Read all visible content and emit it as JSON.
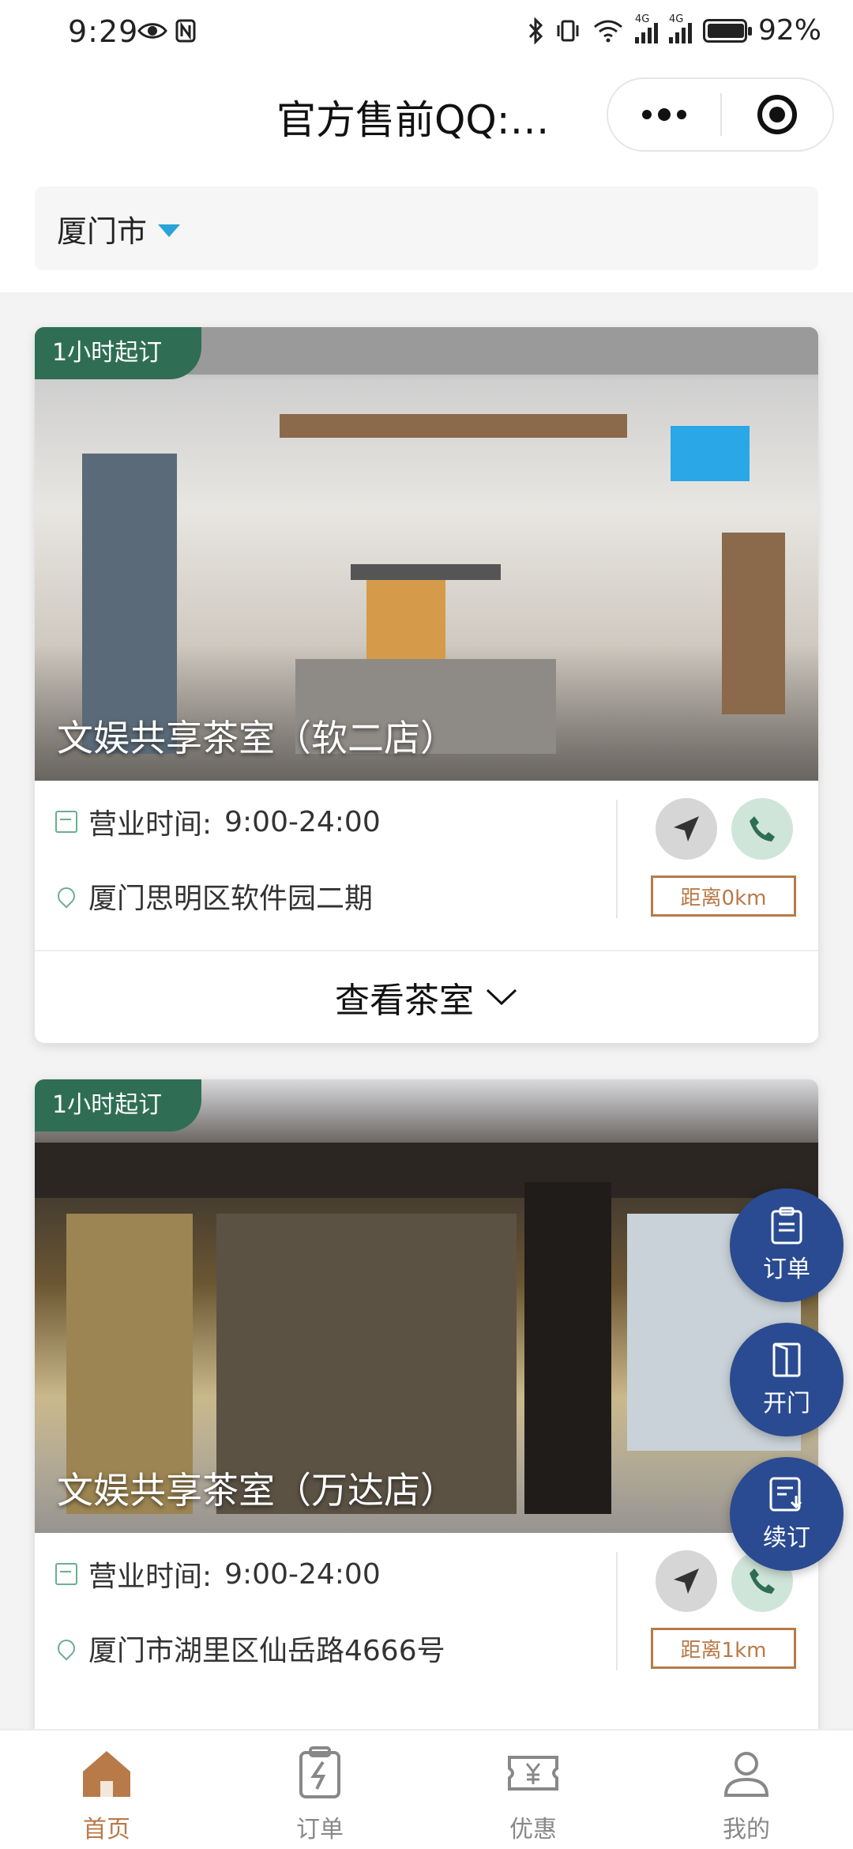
{
  "status_bar": {
    "time": "9:29",
    "battery_percent": "92%",
    "battery_level": 0.92,
    "network_labels": [
      "4G",
      "4G"
    ]
  },
  "header": {
    "title": "官方售前QQ:…",
    "more_icon": "more-dots-icon",
    "close_icon": "target-circle-icon"
  },
  "city_selector": {
    "label": "厦门市",
    "caret_color": "#2aa3d8"
  },
  "stores": [
    {
      "badge": "1小时起订",
      "name": "文娱共享茶室（软二店）",
      "hours_label": "营业时间:",
      "hours": "9:00-24:00",
      "address": "厦门思明区软件园二期",
      "distance": "距离0km",
      "view_label": "查看茶室"
    },
    {
      "badge": "1小时起订",
      "name": "文娱共享茶室（万达店）",
      "hours_label": "营业时间:",
      "hours": "9:00-24:00",
      "address": "厦门市湖里区仙岳路4666号",
      "distance": "距离1km"
    }
  ],
  "fabs": [
    {
      "label": "订单",
      "icon": "clipboard-icon"
    },
    {
      "label": "开门",
      "icon": "door-icon"
    },
    {
      "label": "续订",
      "icon": "renew-icon"
    }
  ],
  "tabbar": [
    {
      "label": "首页",
      "icon": "home-icon",
      "active": true
    },
    {
      "label": "订单",
      "icon": "order-icon",
      "active": false
    },
    {
      "label": "优惠",
      "icon": "coupon-icon",
      "active": false
    },
    {
      "label": "我的",
      "icon": "profile-icon",
      "active": false
    }
  ],
  "colors": {
    "brand_green": "#2f6e55",
    "fab_blue": "#2a4b91",
    "accent_brown": "#b87a48"
  }
}
